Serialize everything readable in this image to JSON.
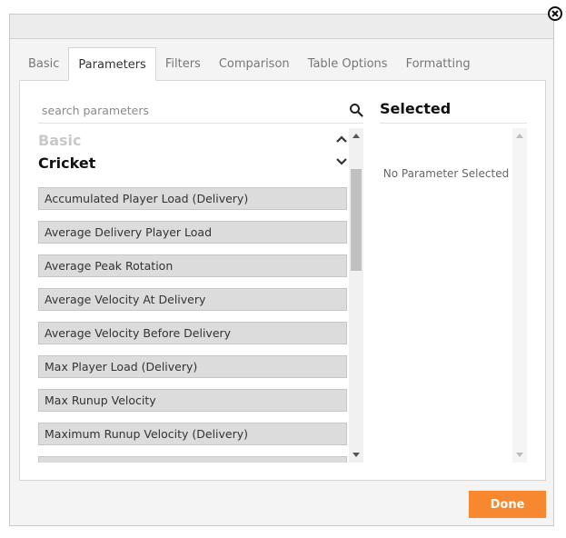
{
  "tabs": [
    {
      "label": "Basic",
      "active": false
    },
    {
      "label": "Parameters",
      "active": true
    },
    {
      "label": "Filters",
      "active": false
    },
    {
      "label": "Comparison",
      "active": false
    },
    {
      "label": "Table Options",
      "active": false
    },
    {
      "label": "Formatting",
      "active": false
    }
  ],
  "search": {
    "placeholder": "search parameters",
    "value": ""
  },
  "groups": {
    "basic": {
      "label": "Basic",
      "state": "collapsed",
      "chevron": "chevron-up-icon"
    },
    "cricket": {
      "label": "Cricket",
      "state": "expanded",
      "chevron": "chevron-down-icon"
    }
  },
  "parameters": [
    "Accumulated Player Load (Delivery)",
    "Average Delivery Player Load",
    "Average Peak Rotation",
    "Average Velocity At Delivery",
    "Average Velocity Before Delivery",
    "Max Player Load (Delivery)",
    "Max Runup Velocity",
    "Maximum Runup Velocity (Delivery)",
    ""
  ],
  "selected": {
    "title": "Selected",
    "empty_text": "No Parameter Selected"
  },
  "footer": {
    "done_label": "Done"
  },
  "colors": {
    "accent": "#f7882f",
    "item_bg": "#dcdcdc",
    "muted_group": "#c9c9c9"
  }
}
